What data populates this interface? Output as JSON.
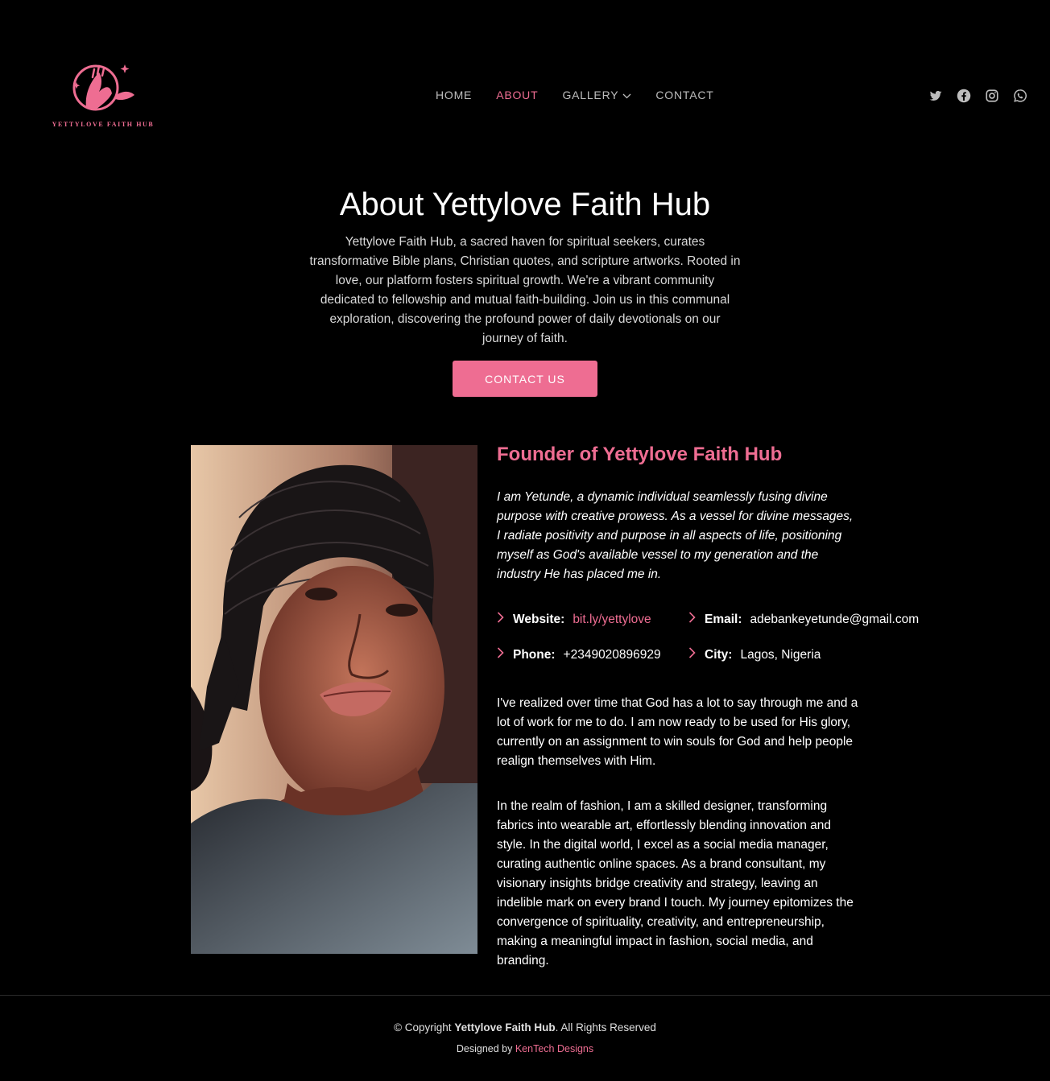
{
  "brand": {
    "logo_text": "YETTYLOVE FAITH HUB"
  },
  "nav": [
    {
      "label": "HOME"
    },
    {
      "label": "ABOUT",
      "active": true
    },
    {
      "label": "GALLERY",
      "has_dropdown": true
    },
    {
      "label": "CONTACT"
    }
  ],
  "social": [
    "twitter-icon",
    "facebook-icon",
    "instagram-icon",
    "whatsapp-icon"
  ],
  "hero": {
    "title": "About Yettylove Faith Hub",
    "text": "Yettylove Faith Hub, a sacred haven for spiritual seekers, curates transformative Bible plans, Christian quotes, and scripture artworks. Rooted in love, our platform fosters spiritual growth. We're a vibrant community dedicated to fellowship and mutual faith-building. Join us in this communal exploration, discovering the profound power of daily devotionals on our journey of faith.",
    "cta": "CONTACT US"
  },
  "founder": {
    "title": "Founder of Yettylove Faith Hub",
    "intro": "I am Yetunde, a dynamic individual seamlessly fusing divine purpose with creative prowess. As a vessel for divine messages, I radiate positivity and purpose in all aspects of life, positioning myself as God's available vessel to my generation and the industry He has placed me in.",
    "details": {
      "website_label": "Website:",
      "website": "bit.ly/yettylove",
      "email_label": "Email:",
      "email": "adebankeyetunde@gmail.com",
      "phone_label": "Phone:",
      "phone": "+2349020896929",
      "city_label": "City:",
      "city": "Lagos, Nigeria"
    },
    "paragraph1": "I've realized over time that God has a lot to say through me and a lot of work for me to do. I am now ready to be used for His glory, currently on an assignment to win souls for God and help people realign themselves with Him.",
    "paragraph2": "In the realm of fashion, I am a skilled designer, transforming fabrics into wearable art, effortlessly blending innovation and style. In the digital world, I excel as a social media manager, curating authentic online spaces. As a brand consultant, my visionary insights bridge creativity and strategy, leaving an indelible mark on every brand I touch. My journey epitomizes the convergence of spirituality, creativity, and entrepreneurship, making a meaningful impact in fashion, social media, and branding."
  },
  "footer": {
    "copy_prefix": "© Copyright",
    "brand": "Yettylove Faith Hub",
    "copy_suffix": ". All Rights Reserved",
    "designed_prefix": "Designed by",
    "designer": "KenTech Designs"
  },
  "colors": {
    "accent": "#ee6d92",
    "background": "#000000"
  }
}
